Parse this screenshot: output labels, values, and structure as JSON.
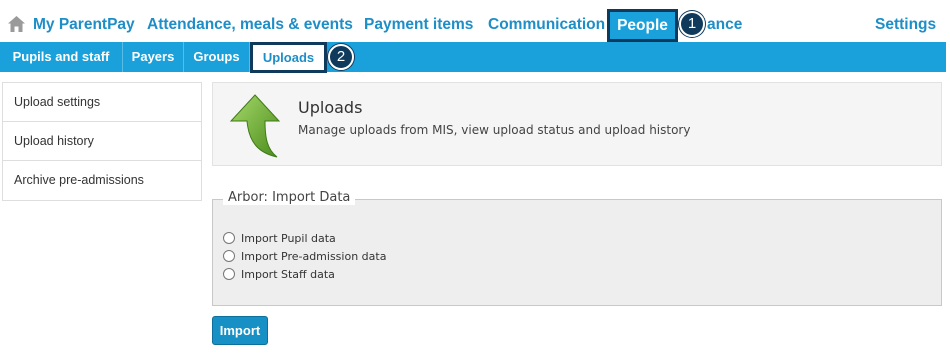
{
  "topnav": {
    "home_label": "My ParentPay",
    "items": [
      "Attendance, meals & events",
      "Payment items",
      "Communication"
    ],
    "people_label": "People",
    "finance_partial": "ance",
    "settings_label": "Settings"
  },
  "subnav": {
    "items": [
      "Pupils and staff",
      "Payers",
      "Groups"
    ],
    "uploads_label": "Uploads"
  },
  "badges": {
    "one": "1",
    "two": "2"
  },
  "sidebar": {
    "items": [
      "Upload settings",
      "Upload history",
      "Archive pre-admissions"
    ]
  },
  "header": {
    "title": "Uploads",
    "subtitle": "Manage uploads from MIS, view upload status and upload history"
  },
  "import_section": {
    "legend": "Arbor: Import Data",
    "options": [
      "Import Pupil data",
      "Import Pre-admission data",
      "Import Staff data"
    ],
    "button_label": "Import"
  },
  "colors": {
    "brand_blue": "#1aa1dc",
    "link_blue": "#1d8ec7",
    "highlight_navy": "#0f3a5c",
    "arrow_green": "#6fae2e"
  },
  "icons": {
    "home": "home-icon",
    "uploads": "green-up-arrow-icon"
  }
}
